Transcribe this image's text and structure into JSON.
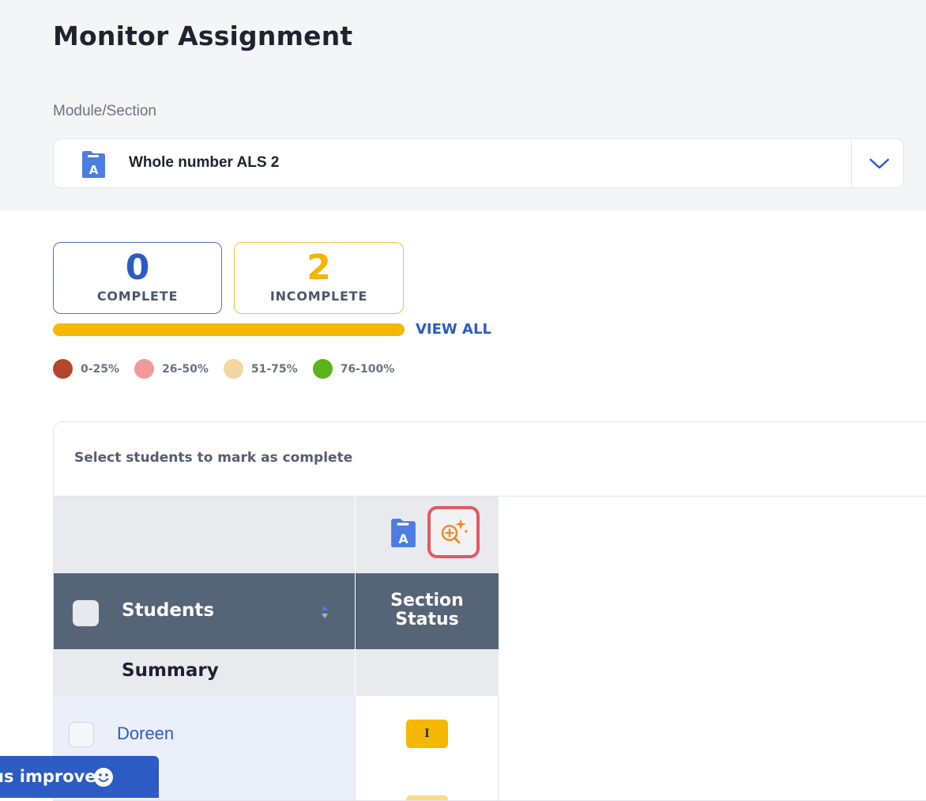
{
  "page": {
    "title": "Monitor Assignment"
  },
  "module_select": {
    "label": "Module/Section",
    "selected": "Whole number ALS 2",
    "file_icon_letter": "A"
  },
  "stats": {
    "complete": {
      "count": "0",
      "label": "COMPLETE"
    },
    "incomplete": {
      "count": "2",
      "label": "INCOMPLETE"
    },
    "progress_incomplete_fraction": 1.0,
    "view_all": "VIEW ALL"
  },
  "legend": [
    {
      "label": "0-25%",
      "color": "#b5452c"
    },
    {
      "label": "26-50%",
      "color": "#f29a98"
    },
    {
      "label": "51-75%",
      "color": "#f4d6a3"
    },
    {
      "label": "76-100%",
      "color": "#5bb51a"
    }
  ],
  "table": {
    "instruction": "Select students to mark as complete",
    "section_icon_letter": "A",
    "headers": {
      "students": "Students",
      "section_status": "Section Status"
    },
    "summary_label": "Summary",
    "rows": [
      {
        "name": "Doreen",
        "status": "I"
      }
    ]
  },
  "feedback": {
    "label": "us improve"
  },
  "colors": {
    "accent": "#2c5bc4",
    "incomplete": "#f5b800",
    "highlight": "#e05a63",
    "ai_icon": "#f08a24"
  }
}
